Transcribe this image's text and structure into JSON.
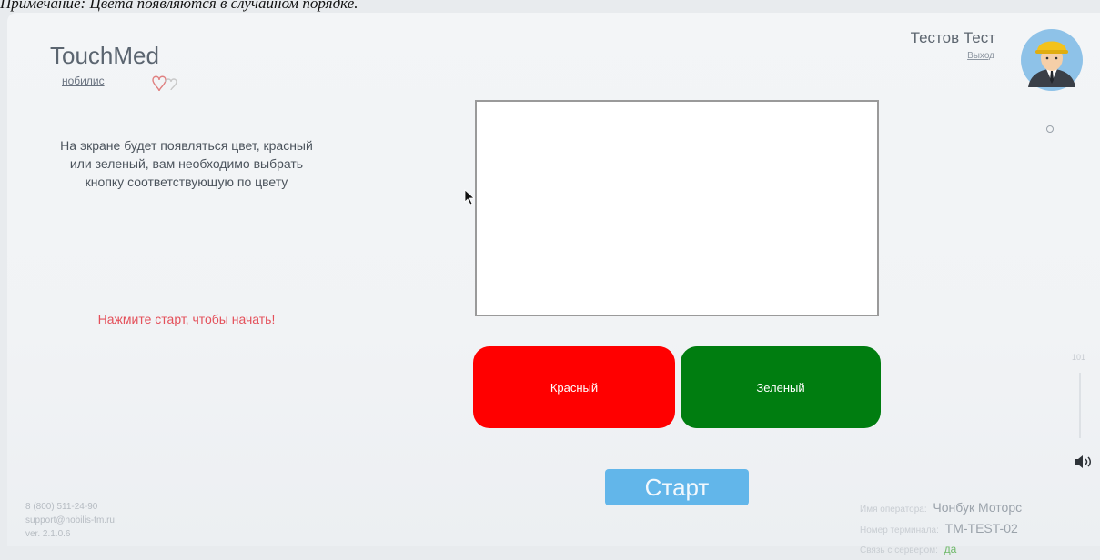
{
  "caption": "Примечание: Цвета появляются в случайном порядке.",
  "logo": {
    "title": "TouchMed",
    "subtitle": "нобилис"
  },
  "instructions": "На экране будет появляться цвет, красный или зеленый, вам необходимо выбрать кнопку соответствующую по цвету",
  "prompt": "Нажмите старт, чтобы начать!",
  "user": {
    "name": "Тестов Тест",
    "logout": "Выход"
  },
  "buttons": {
    "red": "Красный",
    "green": "Зеленый",
    "start": "Старт"
  },
  "volume": {
    "label": "101"
  },
  "contacts": {
    "phone": "8 (800) 511-24-90",
    "email": "support@nobilis-tm.ru",
    "version": "ver. 2.1.0.6"
  },
  "status": {
    "operator_label": "Имя оператора:",
    "operator": "Чонбук Моторс",
    "terminal_label": "Номер терминала:",
    "terminal": "TM-TEST-02",
    "connection_label": "Связь с сервером:",
    "connection": "да"
  },
  "colors": {
    "red": "#ff0000",
    "green": "#007d10",
    "start": "#62b6ea",
    "prompt": "#e4505a"
  }
}
